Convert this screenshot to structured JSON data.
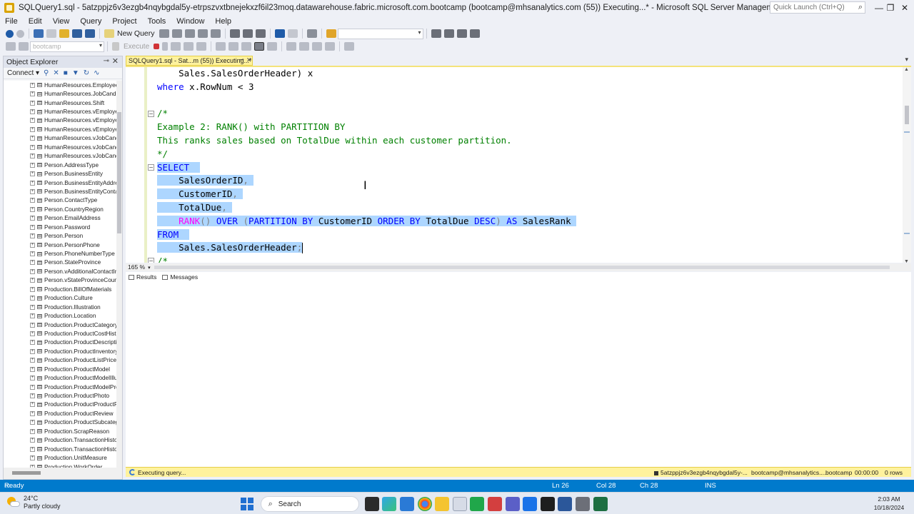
{
  "window": {
    "title": "SQLQuery1.sql - 5atzppjz6v3ezgb4nqybgdal5y-etrpszvxtbnejekxzf6il23moq.datawarehouse.fabric.microsoft.com.bootcamp (bootcamp@mhsanalytics.com (55)) Executing...* - Microsoft SQL Server Management Studio",
    "quick_launch_placeholder": "Quick Launch (Ctrl+Q)",
    "minimize": "—",
    "restore": "❐",
    "close": "✕"
  },
  "menu": [
    "File",
    "Edit",
    "View",
    "Query",
    "Project",
    "Tools",
    "Window",
    "Help"
  ],
  "toolbar": {
    "new_query": "New Query",
    "database": "bootcamp",
    "execute": "Execute"
  },
  "object_explorer": {
    "title": "Object Explorer",
    "connect": "Connect ▾",
    "items": [
      "HumanResources.EmployeeP",
      "HumanResources.JobCandid",
      "HumanResources.Shift",
      "HumanResources.vEmployee",
      "HumanResources.vEmployee",
      "HumanResources.vEmployee",
      "HumanResources.vJobCandi",
      "HumanResources.vJobCandi",
      "HumanResources.vJobCandi",
      "Person.AddressType",
      "Person.BusinessEntity",
      "Person.BusinessEntityAddres",
      "Person.BusinessEntityContac",
      "Person.ContactType",
      "Person.CountryRegion",
      "Person.EmailAddress",
      "Person.Password",
      "Person.Person",
      "Person.PersonPhone",
      "Person.PhoneNumberType",
      "Person.StateProvince",
      "Person.vAdditionalContactIn",
      "Person.vStateProvinceCountr",
      "Production.BillOfMaterials",
      "Production.Culture",
      "Production.Illustration",
      "Production.Location",
      "Production.ProductCategory",
      "Production.ProductCostHisto",
      "Production.ProductDescripti",
      "Production.ProductInventory",
      "Production.ProductListPriceH",
      "Production.ProductModel",
      "Production.ProductModelIllu",
      "Production.ProductModelPro",
      "Production.ProductPhoto",
      "Production.ProductProductP",
      "Production.ProductReview",
      "Production.ProductSubcateg",
      "Production.ScrapReason",
      "Production.TransactionHistor",
      "Production.TransactionHistor",
      "Production.UnitMeasure",
      "Production.WorkOrder"
    ]
  },
  "tab": {
    "label": "SQLQuery1.sql - Sat...m (55)) Executing...*"
  },
  "code": {
    "l1": "    Sales.SalesOrderHeader) x",
    "l2_kw": "where",
    "l2_rest": " x.RowNum < 3",
    "l4": "/*",
    "l5": "Example 2: RANK() with PARTITION BY",
    "l6": "This ranks sales based on TotalDue within each customer partition.",
    "l7": "*/",
    "l8": "SELECT",
    "l9": "SalesOrderID",
    "l10": "CustomerID",
    "l11": "TotalDue",
    "l12_fn": "RANK",
    "l12_over": "OVER",
    "l12_partition": "PARTITION BY",
    "l12_col1": "CustomerID",
    "l12_order": "ORDER BY",
    "l12_col2": "TotalDue",
    "l12_desc": "DESC",
    "l12_as": "AS",
    "l12_alias": "SalesRank",
    "l13": "FROM",
    "l14": "Sales.SalesOrderHeader",
    "l15": "/*"
  },
  "zoom": "165 %",
  "results_tabs": [
    "Results",
    "Messages"
  ],
  "query_status": {
    "state": "Executing query...",
    "server": "5atzppjz6v3ezgb4nqybgdal5y-...",
    "user": "bootcamp@mhsanalytics....",
    "database": "bootcamp",
    "time": "00:00:00",
    "rows": "0 rows"
  },
  "status_bar": {
    "ready": "Ready",
    "ln": "Ln 26",
    "col": "Col 28",
    "ch": "Ch 28",
    "ins": "INS"
  },
  "taskbar": {
    "temp": "24°C",
    "weather": "Partly cloudy",
    "search": "Search",
    "time": "2:03 AM",
    "date": "10/18/2024"
  }
}
